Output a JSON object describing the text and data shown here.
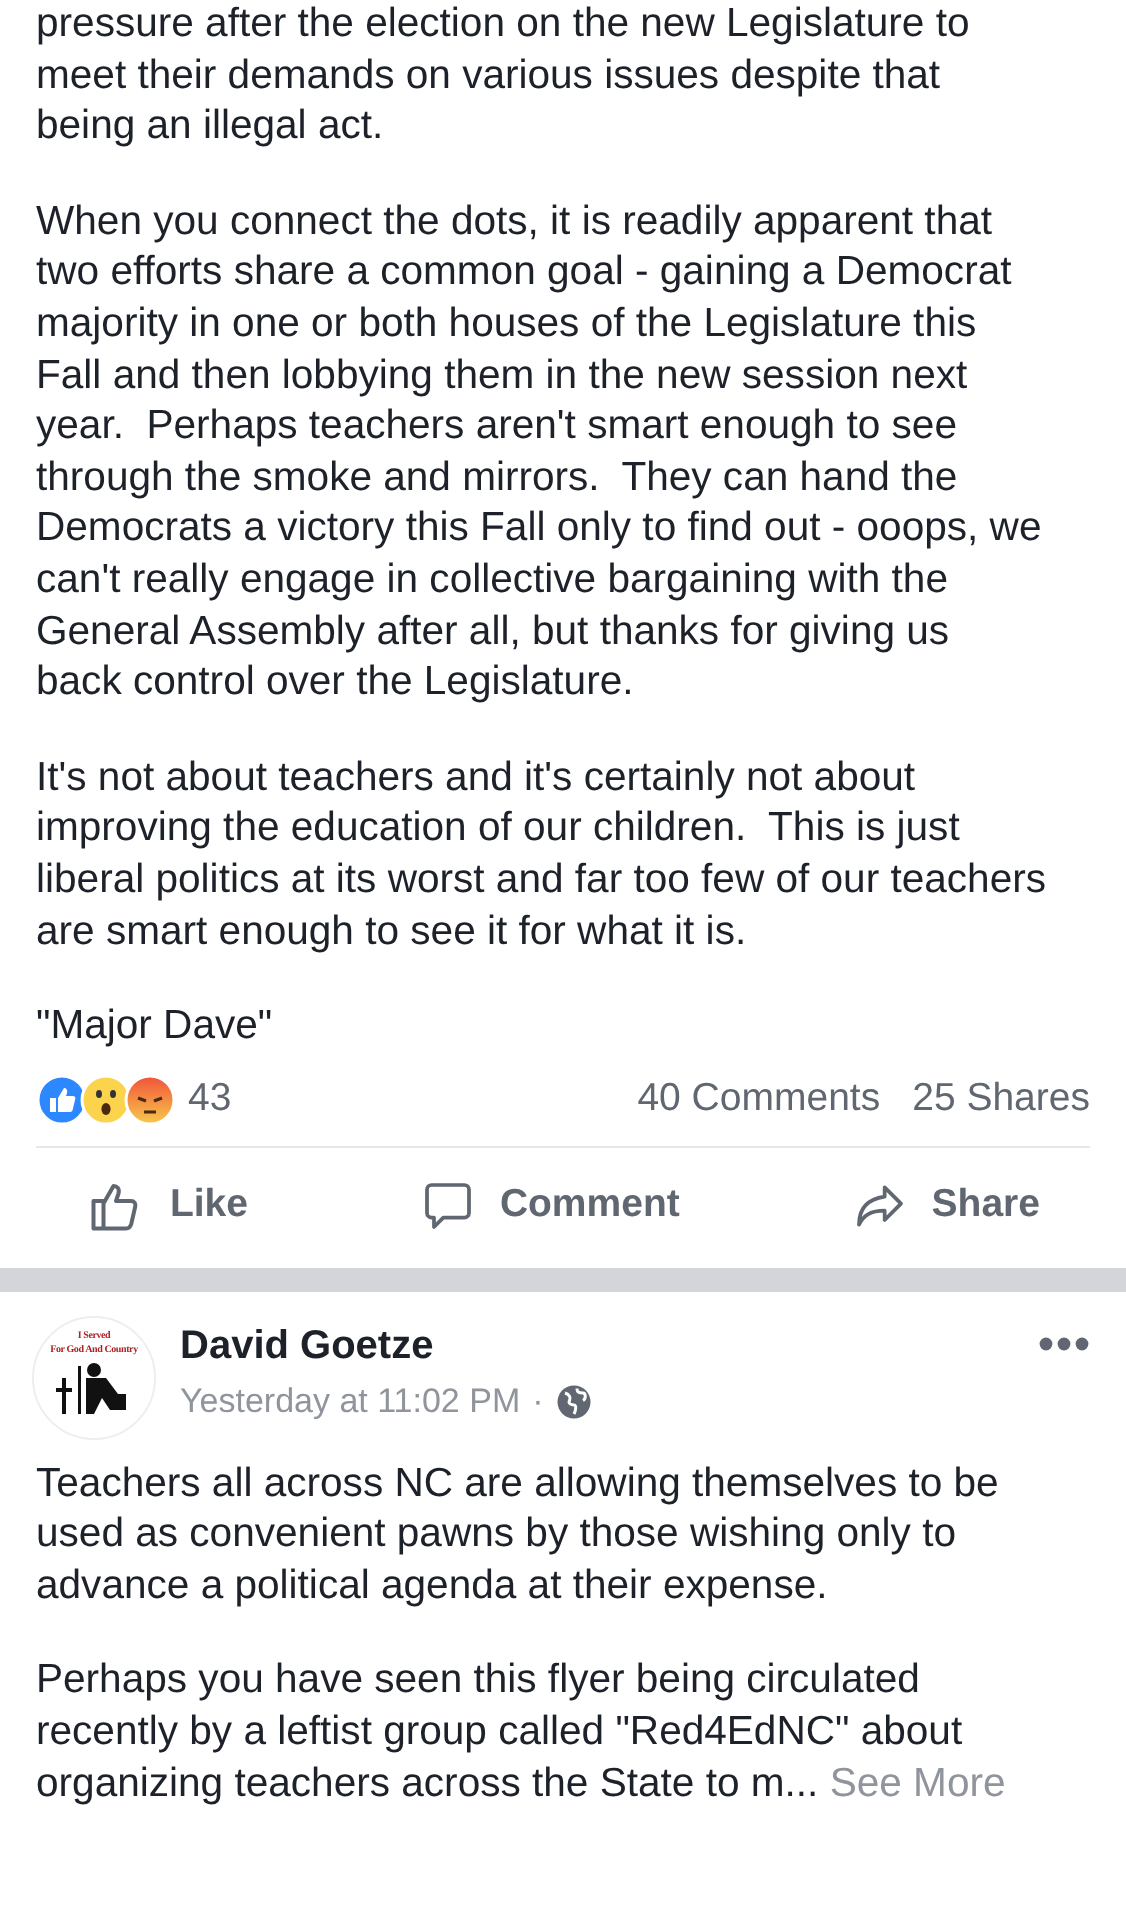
{
  "posts": [
    {
      "paragraphs": [
        "pressure after the election on the new Legislature to meet their demands on various issues despite that being an illegal act.",
        "When you connect the dots, it is readily apparent that two efforts share a common goal - gaining a Democrat majority in one or both houses of the Legislature this Fall and then lobbying them in the new session next year.  Perhaps teachers aren't smart enough to see through the smoke and mirrors.  They can hand the Democrats a victory this Fall only to find out - ooops, we can't really engage in collective bargaining with the General Assembly after all, but thanks for giving us back control over the Legislature.",
        "It's not about teachers and it's certainly not about improving the education of our children.  This is just liberal politics at its worst and far too few of our teachers are smart enough to see it for what it is.",
        "\"Major Dave\""
      ],
      "reactions": {
        "count": "43",
        "comments": "40 Comments",
        "shares": "25 Shares"
      },
      "actions": [
        {
          "kind": "like",
          "label": "Like"
        },
        {
          "kind": "comment",
          "label": "Comment"
        },
        {
          "kind": "share",
          "label": "Share"
        }
      ]
    },
    {
      "author": "David Goetze",
      "avatar_text": [
        "I Served",
        "For God And Country"
      ],
      "time": "Yesterday at 11:02 PM",
      "separator": "·",
      "paragraphs": [
        "Teachers all across NC are allowing themselves to be used as convenient pawns by those wishing only to advance a political agenda at their expense.",
        "Perhaps you have seen this flyer being circulated recently by a leftist group called \"Red4EdNC\" about organizing teachers across the State to m..."
      ],
      "see_more": "See More"
    }
  ]
}
